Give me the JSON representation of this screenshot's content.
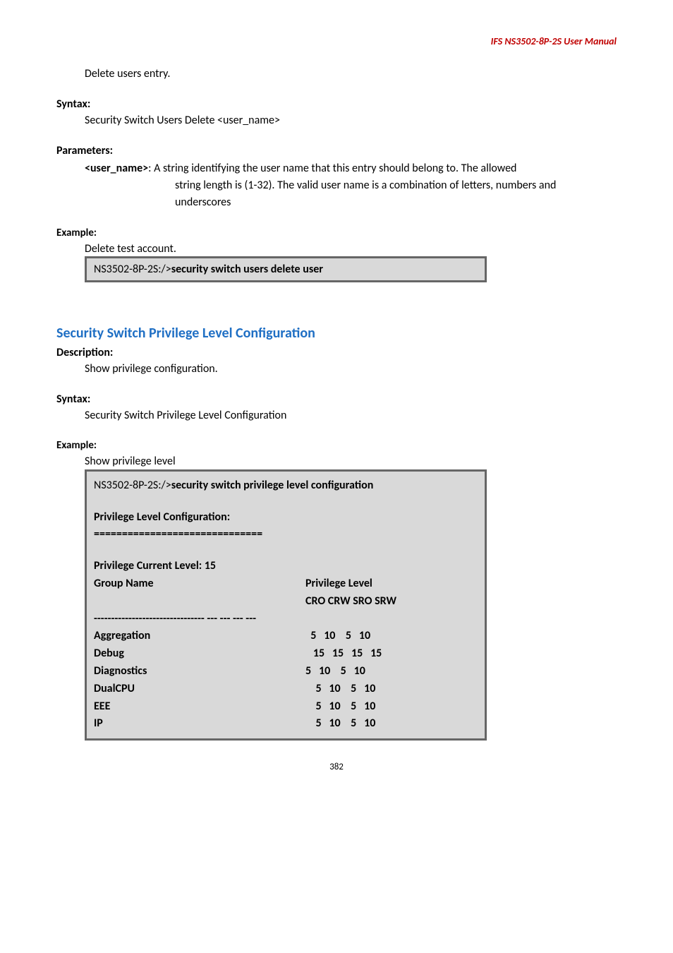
{
  "header": "IFS  NS3502-8P-2S  User  Manual",
  "intro_text": "Delete users entry.",
  "syntax": {
    "label": "Syntax:",
    "text": "Security Switch Users Delete <user_name>"
  },
  "parameters": {
    "label": "Parameters:",
    "param_name": "<user_name>",
    "param_desc_first": ": A string identifying the user name that this entry should belong to. The allowed",
    "param_desc_l2": "string length is (1-32). The valid user name is a combination of letters, numbers and",
    "param_desc_l3": "underscores"
  },
  "example1": {
    "label": "Example:",
    "text": "Delete test account.",
    "cmd_prefix": "NS3502-8P-2S:/>",
    "cmd_bold": "security switch users delete user"
  },
  "section2_title": "Security Switch Privilege Level Configuration",
  "desc2": {
    "label": "Description:",
    "text": "Show privilege configuration."
  },
  "syntax2": {
    "label": "Syntax:",
    "text": "Security Switch Privilege Level Configuration"
  },
  "example2": {
    "label": "Example:",
    "text": "Show privilege level",
    "cmd_line": "NS3502-8P-2S:/>",
    "cmd_bold": "security switch privilege level configuration",
    "heading1": "Privilege Level Configuration:",
    "eqline": "==============================",
    "heading2": "Privilege Current Level: 15",
    "col_group": "Group Name",
    "col_priv": "Privilege Level",
    "col_sub": "CRO CRW SRO SRW",
    "dashline": "-------------------------------- --- --- --- ---",
    "rows": [
      {
        "name": "Aggregation",
        "vals": "  5   10    5   10"
      },
      {
        "name": "Debug",
        "vals": "   15   15   15   15"
      },
      {
        "name": "Diagnostics",
        "vals": "5   10    5   10"
      },
      {
        "name": "DualCPU",
        "vals": "    5   10    5   10"
      },
      {
        "name": "EEE",
        "vals": "    5   10    5   10"
      },
      {
        "name": "IP",
        "vals": "    5   10    5   10"
      }
    ]
  },
  "page_number": "382"
}
